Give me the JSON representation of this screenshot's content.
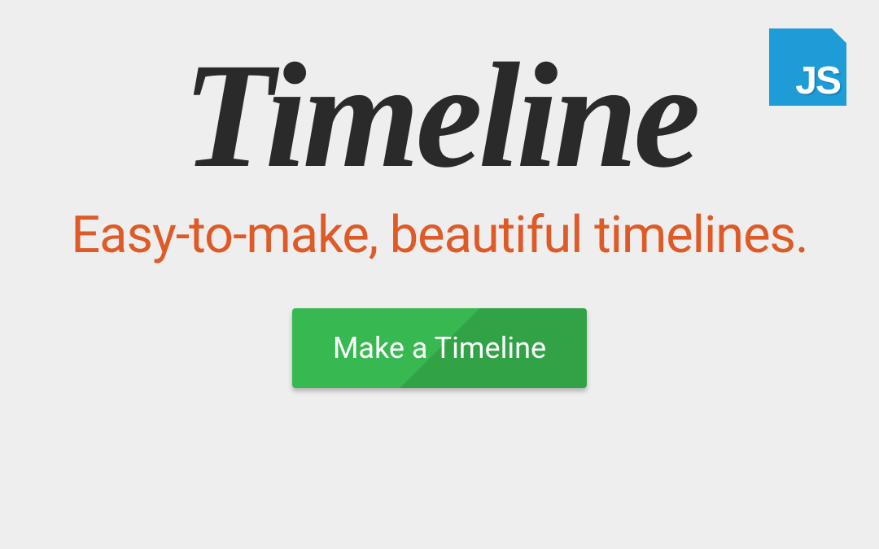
{
  "badge": {
    "label": "JS"
  },
  "hero": {
    "title": "Timeline",
    "subtitle": "Easy-to-make, beautiful timelines.",
    "cta_label": "Make a Timeline"
  },
  "colors": {
    "background": "#eeeeee",
    "title": "#2a2a2a",
    "subtitle": "#de5a27",
    "button": "#38b850",
    "badge": "#1e9cd7"
  }
}
